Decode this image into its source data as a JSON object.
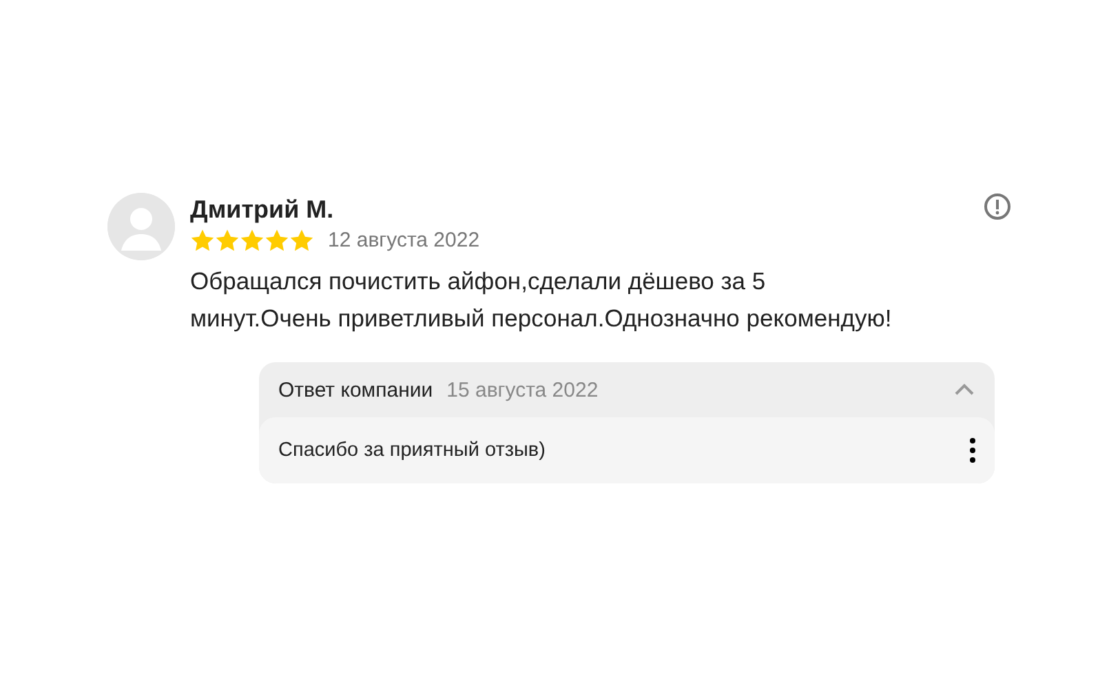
{
  "review": {
    "author": "Дмитрий М.",
    "stars": 5,
    "date": "12 августа 2022",
    "text": "Обращался почистить айфон,сделали дёшево за 5\nминут.Очень приветливый персонал.Однозначно рекомендую!",
    "reply": {
      "title": "Ответ компании",
      "date": "15 августа 2022",
      "expanded": true,
      "text": "Спасибо за приятный отзыв)"
    }
  }
}
